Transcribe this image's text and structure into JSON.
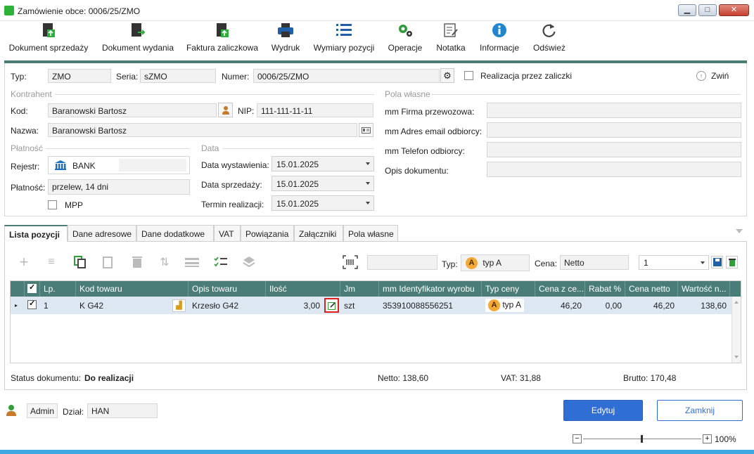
{
  "window": {
    "title": "Zamówienie obce: 0006/25/ZMO",
    "minimize": "▁",
    "maximize": "□",
    "close": "✕"
  },
  "toolbar": [
    {
      "label": "Dokument sprzedaży",
      "icon": "document-sale-icon"
    },
    {
      "label": "Dokument wydania",
      "icon": "document-release-icon"
    },
    {
      "label": "Faktura zaliczkowa",
      "icon": "advance-invoice-icon"
    },
    {
      "label": "Wydruk",
      "icon": "printer-icon"
    },
    {
      "label": "Wymiary pozycji",
      "icon": "list-icon"
    },
    {
      "label": "Operacje",
      "icon": "gears-icon"
    },
    {
      "label": "Notatka",
      "icon": "note-icon"
    },
    {
      "label": "Informacje",
      "icon": "info-icon"
    },
    {
      "label": "Odśwież",
      "icon": "refresh-icon"
    }
  ],
  "header": {
    "typ_label": "Typ:",
    "typ_value": "ZMO",
    "seria_label": "Seria:",
    "seria_value": "sZMO",
    "numer_label": "Numer:",
    "numer_value": "0006/25/ZMO",
    "realizacja_label": "Realizacja przez zaliczki",
    "collapse_label": "Zwiń"
  },
  "kontrahent": {
    "section": "Kontrahent",
    "kod_label": "Kod:",
    "kod_value": "Baranowski Bartosz",
    "nip_label": "NIP:",
    "nip_value": "111-111-11-11",
    "nazwa_label": "Nazwa:",
    "nazwa_value": "Baranowski Bartosz"
  },
  "platnosc": {
    "section": "Płatność",
    "rejestr_label": "Rejestr:",
    "rejestr_value": "BANK",
    "platnosc_label": "Płatność:",
    "platnosc_value": "przelew, 14 dni",
    "mpp_label": "MPP"
  },
  "data": {
    "section": "Data",
    "wystawienia_label": "Data wystawienia:",
    "wystawienia_value": "15.01.2025",
    "sprzedazy_label": "Data sprzedaży:",
    "sprzedazy_value": "15.01.2025",
    "termin_label": "Termin realizacji:",
    "termin_value": "15.01.2025"
  },
  "pola": {
    "section": "Pola własne",
    "firma_label": "mm Firma przewozowa:",
    "email_label": "mm Adres email odbiorcy:",
    "telefon_label": "mm Telefon odbiorcy:",
    "opis_label": "Opis dokumentu:"
  },
  "tabs": [
    "Lista pozycji",
    "Dane adresowe",
    "Dane dodatkowe",
    "VAT",
    "Powiązania",
    "Załączniki",
    "Pola własne"
  ],
  "gridbar": {
    "typ_label": "Typ:",
    "typ_badge": "A",
    "typ_value": "typ A",
    "cena_label": "Cena:",
    "cena_value": "Netto",
    "qty_value": "1"
  },
  "table": {
    "headers": [
      "Lp.",
      "Kod towaru",
      "Opis towaru",
      "Ilość",
      "Jm",
      "mm Identyfikator wyrobu",
      "Typ ceny",
      "Cena z ce...",
      "Rabat %",
      "Cena netto",
      "Wartość n..."
    ],
    "rows": [
      {
        "lp": "1",
        "kod": "K G42",
        "opis": "Krzesło G42",
        "ilosc": "3,00",
        "jm": "szt",
        "identyfikator": "353910088556251",
        "typ_badge": "A",
        "typ": "typ A",
        "cena_z": "46,20",
        "rabat": "0,00",
        "cena_netto": "46,20",
        "wartosc": "138,60"
      }
    ]
  },
  "status": {
    "label": "Status dokumentu:",
    "value": "Do realizacji",
    "netto": "Netto: 138,60",
    "vat": "VAT: 31,88",
    "brutto": "Brutto: 170,48"
  },
  "footer": {
    "user": "Admin",
    "dzial_label": "Dział:",
    "dzial_value": "HAN",
    "edit": "Edytuj",
    "close": "Zamknij",
    "zoom_minus": "−",
    "zoom_plus": "+",
    "zoom": "100%"
  },
  "colors": {
    "accent": "#4a7d77",
    "primary": "#2f6fd3"
  }
}
